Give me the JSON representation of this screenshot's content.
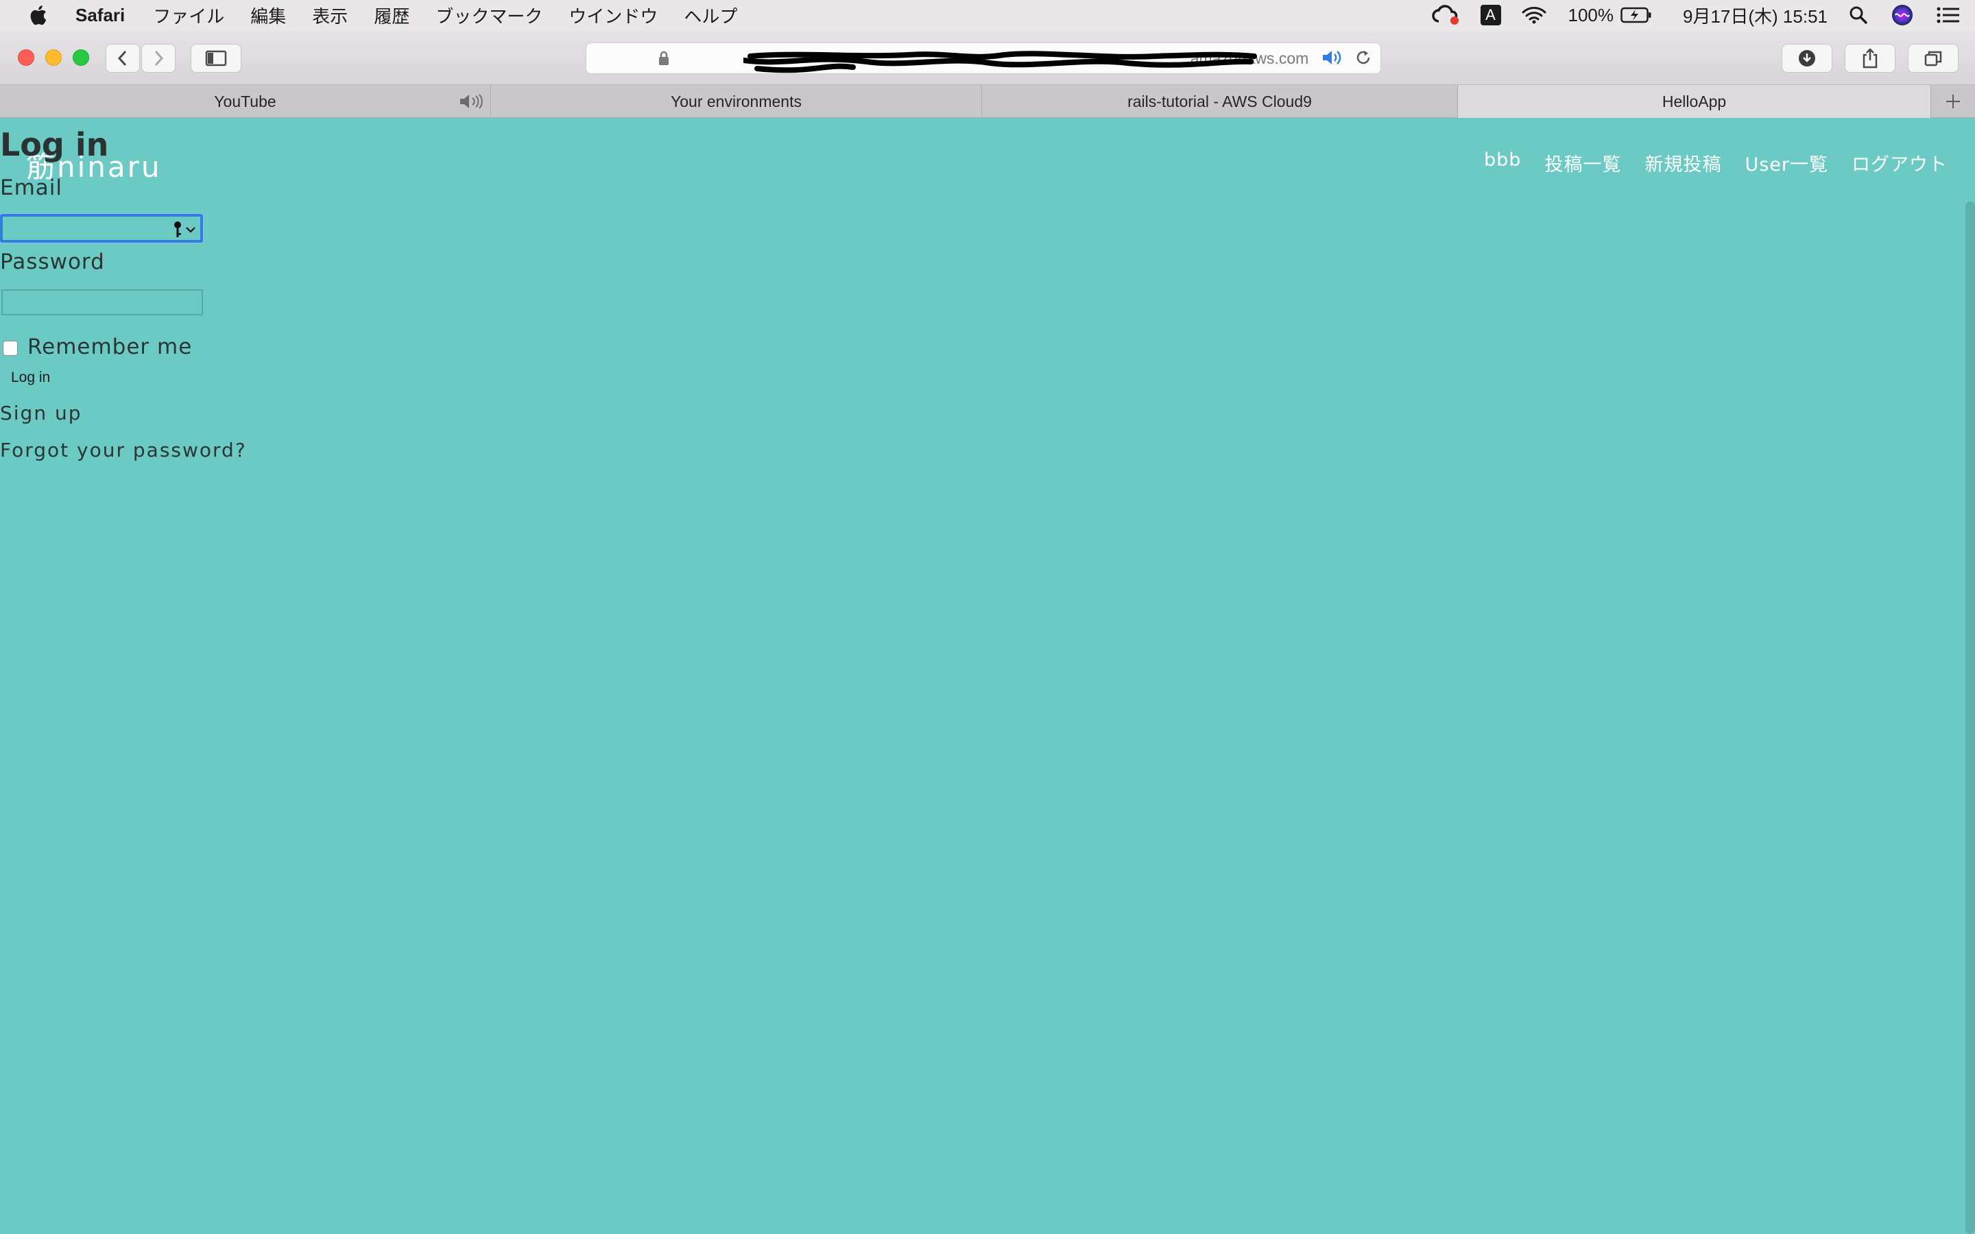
{
  "menubar": {
    "app_name": "Safari",
    "items": [
      "ファイル",
      "編集",
      "表示",
      "履歴",
      "ブックマーク",
      "ウインドウ",
      "ヘルプ"
    ],
    "input_source": "A",
    "battery": "100%",
    "datetime": "9月17日(木)  15:51"
  },
  "browser": {
    "url": "amazonaws.com",
    "tabs": [
      {
        "label": "YouTube",
        "muted_icon": "speaker-icon"
      },
      {
        "label": "Your environments"
      },
      {
        "label": "rails-tutorial - AWS Cloud9"
      },
      {
        "label": "HelloApp",
        "active": true
      }
    ]
  },
  "site": {
    "brand": "筋ninaru",
    "nav": [
      "bbb",
      "投稿一覧",
      "新規投稿",
      "User一覧",
      "ログアウト"
    ]
  },
  "login": {
    "title": "Log in",
    "email_label": "Email",
    "email_value": "",
    "password_label": "Password",
    "password_value": "",
    "remember_label": "Remember me",
    "submit_label": "Log in",
    "signup_link": "Sign up",
    "forgot_link": "Forgot your password?"
  },
  "colors": {
    "page_background": "#6ccac4",
    "focus_ring": "#2f7ee0"
  }
}
